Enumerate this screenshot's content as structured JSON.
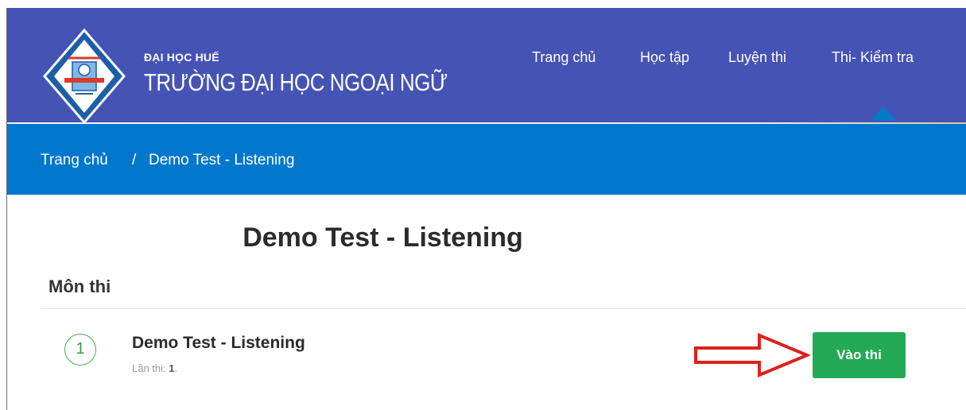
{
  "header": {
    "university": "ĐẠI HỌC HUẾ",
    "school": "TRƯỜNG ĐẠI HỌC NGOẠI NGỮ",
    "logo_icon": "university-logo-icon",
    "nav": [
      "Trang chủ",
      "Học tập",
      "Luyện thi",
      "Thi- Kiểm tra"
    ],
    "active_nav": "Thi- Kiểm tra"
  },
  "breadcrumb": {
    "home": "Trang chủ",
    "separator": "/",
    "current": "Demo Test - Listening"
  },
  "page": {
    "title": "Demo Test - Listening",
    "section_label": "Môn thi"
  },
  "exam_items": [
    {
      "number": "1",
      "title": "Demo Test - Listening",
      "attempts_label": "Lần thi:",
      "attempts_value": "1",
      "attempts_suffix": ".",
      "button_label": "Vào thi"
    }
  ],
  "annotation": {
    "icon": "red-arrow-icon",
    "color": "#e0201c"
  },
  "colors": {
    "header": "#4553b4",
    "breadcrumb_bar": "#0077cc",
    "accent_green": "#24a956"
  }
}
